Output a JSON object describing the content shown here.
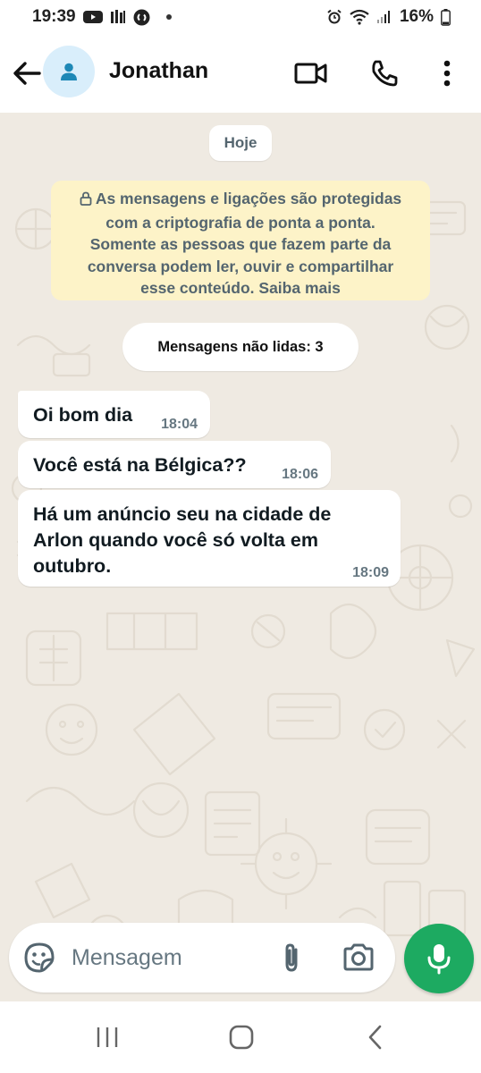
{
  "status_bar": {
    "time": "19:39",
    "battery": "16%",
    "icons": [
      "youtube-icon",
      "app-icon",
      "shazam-icon",
      "alarm-icon",
      "wifi-icon",
      "signal-icon",
      "battery-icon"
    ]
  },
  "header": {
    "contact_name": "Jonathan",
    "icons": [
      "back-arrow-icon",
      "avatar-person-icon",
      "video-call-icon",
      "phone-icon",
      "more-vert-icon"
    ]
  },
  "chat": {
    "date_label": "Hoje",
    "encryption_notice": "As mensagens e ligações são protegidas com a criptografia de ponta a ponta. Somente as pessoas que fazem parte da conversa podem ler, ouvir e compartilhar esse conteúdo. Saiba mais",
    "encryption_line1": "As mensagens e ligações são protegidas",
    "encryption_line2": "com a criptografia de ponta a ponta.",
    "encryption_line3": "Somente as pessoas que fazem parte da",
    "encryption_line4": "conversa podem ler, ouvir e compartilhar",
    "encryption_line5": "esse conteúdo. Saiba mais",
    "unread_label": "Mensagens não lidas: 3",
    "messages": [
      {
        "text": "Oi bom dia",
        "time": "18:04"
      },
      {
        "text": "Você está na Bélgica??",
        "time": "18:06"
      },
      {
        "text_line1": "Há um anúncio seu na cidade de",
        "text_line2": "Arlon quando você só volta em",
        "text_line3": "outubro.",
        "time": "18:09"
      }
    ]
  },
  "composer": {
    "placeholder": "Mensagem",
    "icons": [
      "sticker-icon",
      "attach-icon",
      "camera-icon",
      "mic-icon"
    ]
  },
  "nav_bar": {
    "icons": [
      "recent-apps-icon",
      "home-icon",
      "back-icon"
    ]
  },
  "colors": {
    "chat_background": "#efeae2",
    "encryption_background": "#fdf3c8",
    "mic_button": "#1daa61",
    "timestamp": "#667781"
  }
}
